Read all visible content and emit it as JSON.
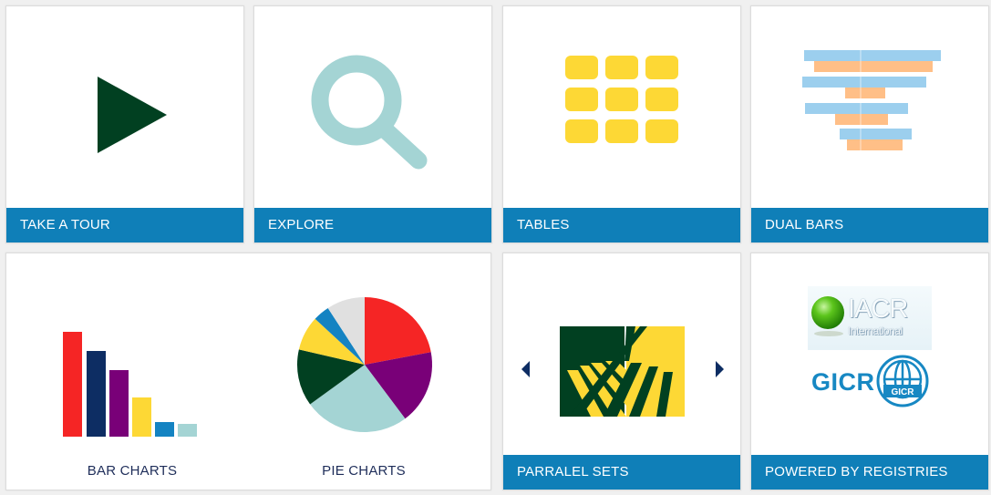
{
  "tiles": {
    "tour": {
      "label": "TAKE A TOUR",
      "icon": "play-icon"
    },
    "explore": {
      "label": "EXPLORE",
      "icon": "search-icon"
    },
    "tables": {
      "label": "TABLES",
      "icon": "grid-icon"
    },
    "dual_bars": {
      "label": "DUAL BARS",
      "icon": "dual-bars-icon"
    },
    "bar_charts": {
      "label": "BAR CHARTS",
      "icon": "bar-chart-icon"
    },
    "pie_charts": {
      "label": "PIE CHARTS",
      "icon": "pie-chart-icon"
    },
    "parallel_sets": {
      "label": "PARRALEL SETS",
      "icon": "parallel-sets-icon"
    },
    "registries": {
      "label": "POWERED BY REGISTRIES",
      "logo_iacr": "IACR",
      "logo_iacr_sub": "International",
      "logo_gicr": "GICR",
      "logo_gicr_badge": "GICR"
    }
  },
  "colors": {
    "footer": "#0f7fb8",
    "play": "#014021",
    "search": "#a4d4d4",
    "tables": "#fdd835",
    "dual_blue": "#9ccfee",
    "dual_orange": "#ffbf87",
    "red": "#f52525",
    "navy": "#0d2d63",
    "purple": "#790078",
    "yellow": "#fdd835",
    "blue": "#1483c2",
    "teal": "#a4d4d4",
    "green": "#014021",
    "grey": "#e0e0e0"
  }
}
